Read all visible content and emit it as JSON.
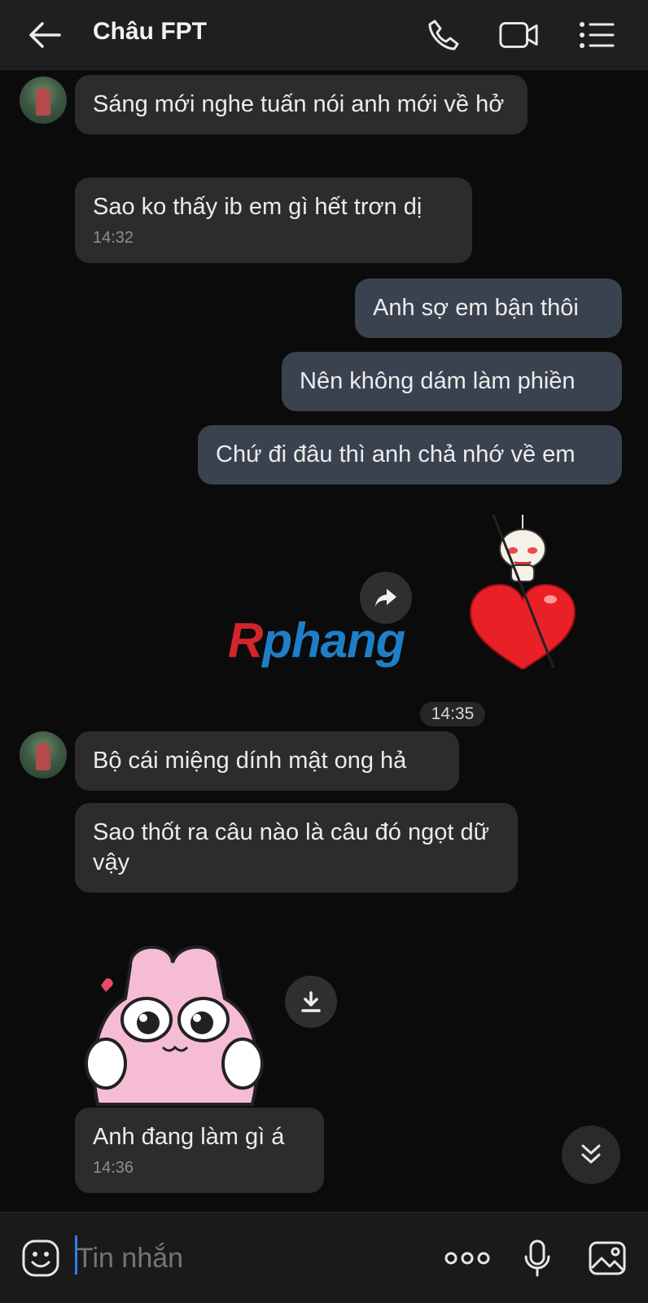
{
  "header": {
    "title": "Châu FPT",
    "icons": [
      "back-arrow-icon",
      "phone-icon",
      "video-call-icon",
      "menu-list-icon"
    ]
  },
  "messages": {
    "m1": {
      "text": "Sáng mới nghe tuấn nói anh mới về hở"
    },
    "m2": {
      "text": "Sao ko thấy ib em gì hết trơn dị",
      "time": "14:32"
    },
    "m3": {
      "text": "Anh sợ em bận thôi"
    },
    "m4": {
      "text": "Nên không dám làm phiền"
    },
    "m5": {
      "text": "Chứ đi đâu thì anh chả nhớ về em"
    },
    "divider_time": "14:35",
    "m6": {
      "text": "Bộ cái miệng dính mật ong hả"
    },
    "m7": {
      "text": "Sao thốt ra câu nào là câu đó ngọt dữ vậy"
    },
    "m8": {
      "text": "Anh đang làm gì á",
      "time": "14:36"
    }
  },
  "watermark": {
    "first": "R",
    "rest": "phang"
  },
  "stickers": [
    "heart-character-sticker",
    "pink-bunny-sticker"
  ],
  "input": {
    "placeholder": "Tin nhắn"
  },
  "colors": {
    "background": "#0b0b0b",
    "incoming_bubble": "#2c2c2c",
    "outgoing_bubble": "#3a4250",
    "caret": "#2f7ee8"
  }
}
